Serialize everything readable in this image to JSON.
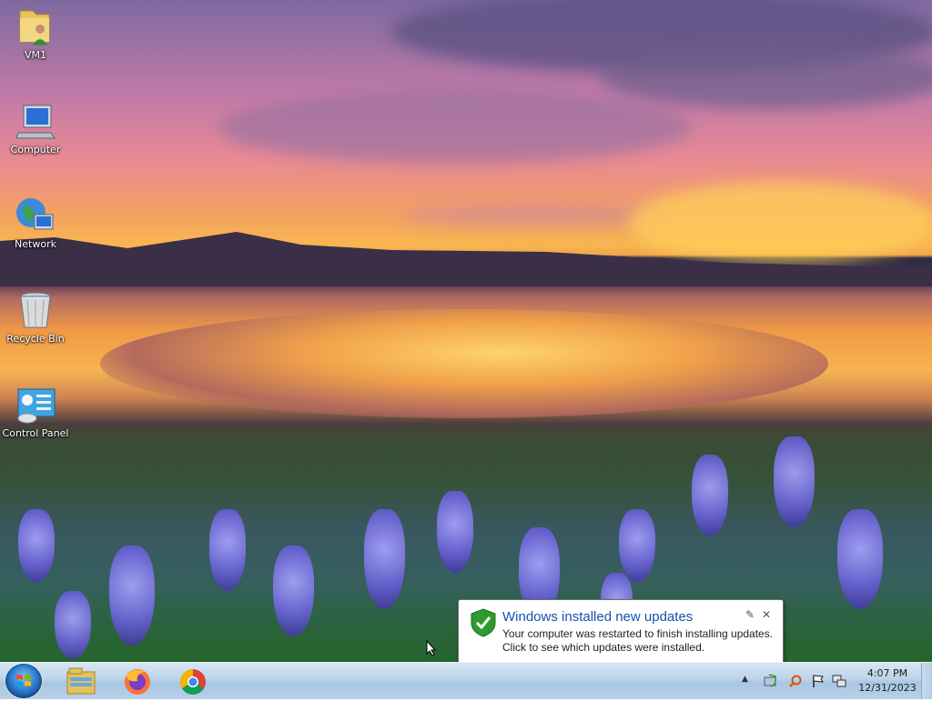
{
  "desktop": {
    "icons": [
      {
        "label": "VM1",
        "icon": "user-folder-icon"
      },
      {
        "label": "Computer",
        "icon": "computer-icon"
      },
      {
        "label": "Network",
        "icon": "network-icon"
      },
      {
        "label": "Recycle Bin",
        "icon": "recycle-bin-icon"
      },
      {
        "label": "Control Panel",
        "icon": "control-panel-icon"
      }
    ]
  },
  "notification": {
    "title": "Windows installed new updates",
    "line1": "Your computer was restarted to finish installing updates.",
    "line2": "Click to see which updates were installed.",
    "icon": "shield-check-icon"
  },
  "taskbar": {
    "pinned": [
      {
        "name": "File Explorer",
        "icon": "file-explorer-icon"
      },
      {
        "name": "Firefox",
        "icon": "firefox-icon"
      },
      {
        "name": "Chrome",
        "icon": "chrome-icon"
      }
    ],
    "clock": {
      "time": "4:07 PM",
      "date": "12/31/2023"
    }
  },
  "colors": {
    "accent": "#1a4fb0",
    "taskbar": "#bcd3ea"
  }
}
